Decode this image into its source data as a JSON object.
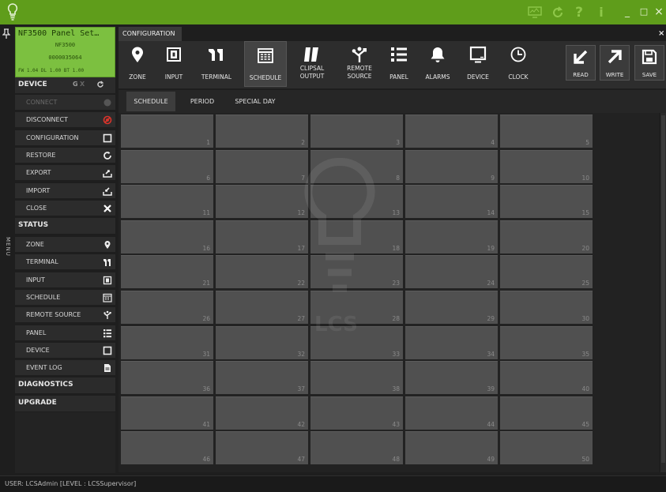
{
  "titlebar": {
    "icons": [
      "bulb-icon",
      "monitor-icon",
      "refresh-icon",
      "help-icon",
      "info-icon"
    ],
    "help_glyph": "?",
    "info_glyph": "i",
    "minimize": "_",
    "maximize": "□",
    "close": "×"
  },
  "sidebar": {
    "menu_label": "MENU",
    "device_panel": {
      "title": "NF3500 Panel Set…",
      "model": "NF3500",
      "serial": "0000035064",
      "versions": "FW 1.04  DL 1.00  BT 1.00"
    },
    "device_section": {
      "label": "DEVICE",
      "ctl_g": "G",
      "ctl_x": "X"
    },
    "device_items": [
      {
        "label": "CONNECT",
        "icon": "connect-icon",
        "disabled": true
      },
      {
        "label": "DISCONNECT",
        "icon": "disconnect-icon"
      },
      {
        "label": "CONFIGURATION",
        "icon": "configuration-icon"
      },
      {
        "label": "RESTORE",
        "icon": "restore-icon"
      },
      {
        "label": "EXPORT",
        "icon": "export-icon"
      },
      {
        "label": "IMPORT",
        "icon": "import-icon"
      },
      {
        "label": "CLOSE",
        "icon": "close-icon"
      }
    ],
    "status_section": {
      "label": "STATUS"
    },
    "status_items": [
      {
        "label": "ZONE",
        "icon": "zone-icon"
      },
      {
        "label": "TERMINAL",
        "icon": "terminal-icon"
      },
      {
        "label": "INPUT",
        "icon": "input-icon"
      },
      {
        "label": "SCHEDULE",
        "icon": "schedule-icon"
      },
      {
        "label": "REMOTE SOURCE",
        "icon": "remote-source-icon"
      },
      {
        "label": "PANEL",
        "icon": "panel-icon"
      },
      {
        "label": "DEVICE",
        "icon": "device-icon"
      },
      {
        "label": "EVENT LOG",
        "icon": "event-log-icon"
      }
    ],
    "diagnostics_section": {
      "label": "DIAGNOSTICS"
    },
    "upgrade_section": {
      "label": "UPGRADE"
    }
  },
  "config_tab": {
    "label": "CONFIGURATION",
    "close": "×"
  },
  "toolbar": {
    "tools": [
      {
        "label": "ZONE",
        "icon": "zone-icon"
      },
      {
        "label": "INPUT",
        "icon": "input-icon"
      },
      {
        "label": "TERMINAL",
        "icon": "terminal-icon"
      },
      {
        "label": "SCHEDULE",
        "icon": "schedule-icon",
        "active": true
      },
      {
        "label": "CLIPSAL",
        "label2": "OUTPUT",
        "icon": "clipsal-output-icon"
      },
      {
        "label": "REMOTE",
        "label2": "SOURCE",
        "icon": "remote-source-icon"
      },
      {
        "label": "PANEL",
        "icon": "panel-icon"
      },
      {
        "label": "ALARMS",
        "icon": "alarms-icon"
      },
      {
        "label": "DEVICE",
        "icon": "device-icon"
      },
      {
        "label": "CLOCK",
        "icon": "clock-icon"
      }
    ],
    "actions": [
      {
        "label": "READ",
        "icon": "read-arrow-icon"
      },
      {
        "label": "WRITE",
        "icon": "write-arrow-icon"
      },
      {
        "label": "SAVE",
        "icon": "save-icon"
      }
    ]
  },
  "subtabs": [
    {
      "label": "SCHEDULE",
      "active": true
    },
    {
      "label": "PERIOD"
    },
    {
      "label": "SPECIAL DAY"
    }
  ],
  "schedule_cells": [
    "1",
    "2",
    "3",
    "4",
    "5",
    "6",
    "7",
    "8",
    "9",
    "10",
    "11",
    "12",
    "13",
    "14",
    "15",
    "16",
    "17",
    "18",
    "19",
    "20",
    "21",
    "22",
    "23",
    "24",
    "25",
    "26",
    "27",
    "28",
    "29",
    "30",
    "31",
    "32",
    "33",
    "34",
    "35",
    "36",
    "37",
    "38",
    "39",
    "40",
    "41",
    "42",
    "43",
    "44",
    "45",
    "46",
    "47",
    "48",
    "49",
    "50"
  ],
  "watermark": {
    "text": "LCS"
  },
  "statusbar": {
    "text": "USER: LCSAdmin [LEVEL : LCSSupervisor]"
  },
  "colors": {
    "accent": "#5f9d1b",
    "device_panel": "#7cc040",
    "danger": "#d9342b"
  }
}
